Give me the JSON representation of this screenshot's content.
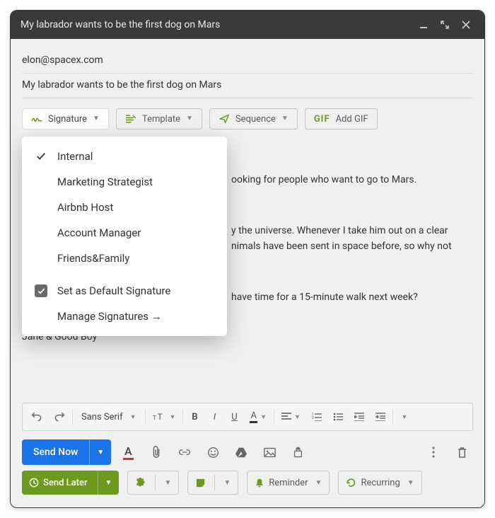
{
  "window": {
    "title": "My labrador wants to be the first dog on Mars"
  },
  "fields": {
    "to": "elon@spacex.com",
    "subject": "My labrador wants to be the first dog on Mars"
  },
  "toolbar": {
    "signature": "Signature",
    "template": "Template",
    "sequence": "Sequence",
    "addgif": "Add GIF",
    "gif_prefix": "GIF"
  },
  "signature_menu": {
    "items": [
      {
        "label": "Internal",
        "checked": true
      },
      {
        "label": "Marketing Strategist",
        "checked": false
      },
      {
        "label": "Airbnb Host",
        "checked": false
      },
      {
        "label": "Account Manager",
        "checked": false
      },
      {
        "label": "Friends&Family",
        "checked": false
      }
    ],
    "set_default": "Set as Default Signature",
    "manage": "Manage Signatures →"
  },
  "body": {
    "visible_line_1_fragment": "ooking for people who want to go to Mars.",
    "visible_para_2a_fragment": "y the universe. Whenever I take him out on a clear",
    "visible_para_2b_fragment": "nimals have been sent in space before, so why not",
    "visible_line_3_fragment": "have time for a 15-minute walk next week?",
    "signoff": "Jane & Good Boy"
  },
  "format_bar": {
    "font": "Sans Serif"
  },
  "actions": {
    "send_now": "Send Now",
    "send_later": "Send Later",
    "reminder": "Reminder",
    "recurring": "Recurring"
  }
}
